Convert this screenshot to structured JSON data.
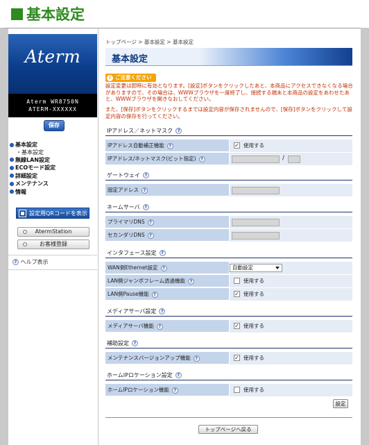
{
  "heading": "基本設定",
  "sidebar": {
    "logo": "Aterm",
    "model_line1": "Aterm WR8750N",
    "model_line2": "ATERM-XXXXXX",
    "save_label": "保存",
    "nav": [
      {
        "label": "基本設定"
      },
      {
        "label": "・基本設定",
        "sub": true
      },
      {
        "label": "無線LAN設定"
      },
      {
        "label": "ECOモード設定"
      },
      {
        "label": "詳細設定"
      },
      {
        "label": "メンテナンス"
      },
      {
        "label": "情報"
      }
    ],
    "qr_label": "設定用QRコードを表示",
    "aterm_station_label": "AtermStation",
    "register_label": "お客様登録",
    "help_label": "ヘルプ表示"
  },
  "main": {
    "breadcrumb": "トップページ > 基本設定 > 基本設定",
    "title": "基本設定",
    "notice_badge": "ご注意ください",
    "notice1": "設定変更は即時に有効となります。[設定]ボタンをクリックしたあと、本商品にアクセスできなくなる場合がありますので、その場合は、WWWブラウザを一度終了し、接続する端末と本商品の設定をあわせたあと、WWWブラウザを開きなおしてください。",
    "notice2": "また、[保存]ボタンをクリックするまでは設定内容が保存されませんので、[保存]ボタンをクリックして設定内容の保存を行ってください。",
    "sections": {
      "ip": {
        "title": "IPアドレス／ネットマスク",
        "auto_label": "IPアドレス自動補正機能",
        "auto_value": "使用する",
        "addr_label": "IPアドレス/ネットマスク(ビット指定)",
        "slash": "/"
      },
      "gateway": {
        "title": "ゲートウェイ",
        "fixed_label": "固定アドレス"
      },
      "dns": {
        "title": "ネームサーバ",
        "primary_label": "プライマリDNS",
        "secondary_label": "セカンダリDNS"
      },
      "iface": {
        "title": "インタフェース設定",
        "wan_label": "WAN側Ethernet設定",
        "wan_value": "自動設定",
        "jumbo_label": "LAN側ジャンボフレーム透過機能",
        "jumbo_value": "使用する",
        "pause_label": "LAN側Pause機能",
        "pause_value": "使用する"
      },
      "media": {
        "title": "メディアサーバ設定",
        "func_label": "メディアサーバ機能",
        "func_value": "使用する"
      },
      "aux": {
        "title": "補助設定",
        "maint_label": "メンテナンスバージョンアップ機能",
        "maint_value": "使用する"
      },
      "home": {
        "title": "ホームIPロケーション設定",
        "func_label": "ホームIPロケーション機能",
        "func_value": "使用する"
      }
    },
    "apply_label": "設定",
    "back_label": "トップページへ戻る"
  },
  "checks": {
    "ip_auto": true,
    "jumbo": false,
    "pause": true,
    "media": true,
    "maint": true,
    "home": false
  },
  "colors": {
    "heading_green": "#2e8b1e",
    "row_label_bg": "#c4d4ea",
    "row_value_bg": "#e6ecf6",
    "notice_red": "#c22d00",
    "badge_orange": "#f5a400",
    "brand_blue": "#0b3d8c"
  }
}
